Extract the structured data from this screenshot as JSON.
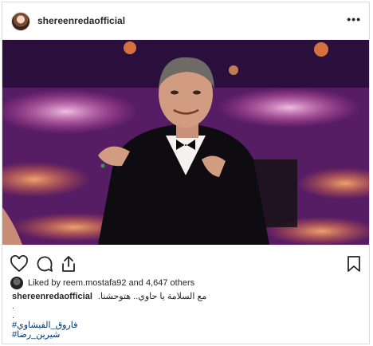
{
  "post": {
    "username": "shereenredaofficial",
    "more_label": "•••"
  },
  "likes": {
    "text": "Liked by reem.mostafa92 and 4,647 others"
  },
  "caption": {
    "username": "shereenredaofficial",
    "text": "مع السلامة يا حاوي.. هتوحشنا.",
    "dot1": ".",
    "dot2": ".",
    "hashtag1": "#فاروق_الفيشاوي",
    "hashtag2": "#شيرين_رضا"
  },
  "icons": {
    "like": "heart-icon",
    "comment": "comment-icon",
    "share": "share-icon",
    "save": "bookmark-icon",
    "more": "more-icon"
  }
}
